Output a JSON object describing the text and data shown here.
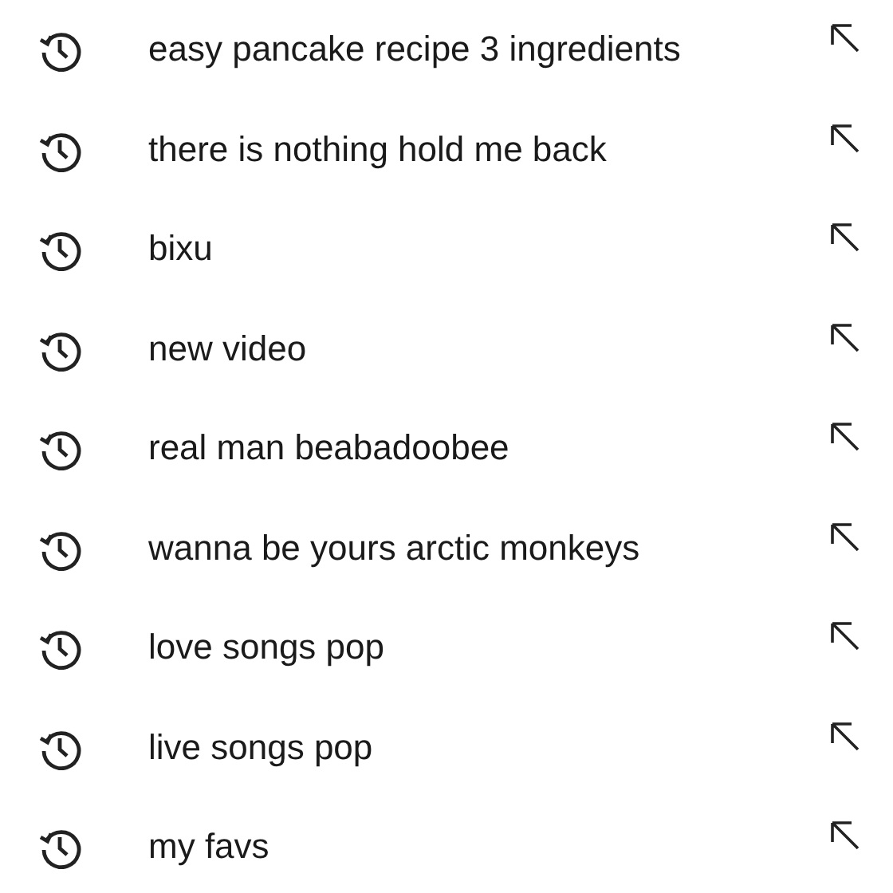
{
  "history": [
    {
      "query": "easy pancake recipe 3 ingredients"
    },
    {
      "query": "there is nothing hold me back"
    },
    {
      "query": "bixu"
    },
    {
      "query": "new video"
    },
    {
      "query": "real man beabadoobee"
    },
    {
      "query": "wanna be yours arctic monkeys"
    },
    {
      "query": "love songs pop"
    },
    {
      "query": "live songs pop"
    },
    {
      "query": "my favs"
    }
  ]
}
